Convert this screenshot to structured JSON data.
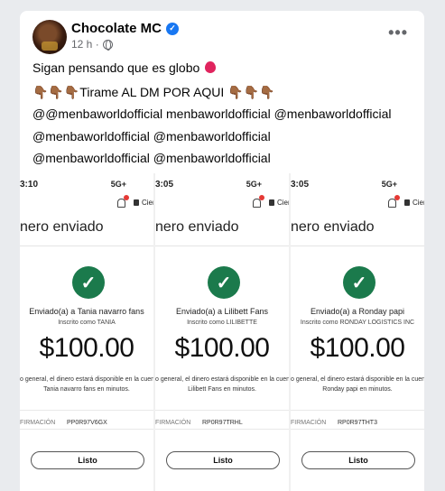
{
  "post": {
    "author": "Chocolate MC",
    "time": "12 h ·",
    "more_label": "•••",
    "lines": [
      "Sigan pensando que es globo",
      "👇🏾👇🏾👇🏾Tirame AL DM POR AQUI 👇🏾👇🏾👇🏾",
      "@@menbaworldofficial menbaworldofficial @menbaworldofficial",
      "@menbaworldofficial @menbaworldofficial",
      "@menbaworldofficial @menbaworldofficial"
    ]
  },
  "screenshots": [
    {
      "time": "3:10",
      "signal": "5G+",
      "close": "Cierr",
      "heading": "nero enviado",
      "sent_to": "Enviado(a) a Tania navarro fans",
      "inscrito": "Inscrito como TANIA",
      "amount": "$100.00",
      "avail_1": "o general, el dinero estará disponible en la cuen",
      "avail_2": "Tania navarro fans en minutos.",
      "firma": "FIRMACIÓN",
      "ref": "PP0R97V6GX",
      "button": "Listo"
    },
    {
      "time": "3:05",
      "signal": "5G+",
      "close": "Cierr",
      "heading": "nero enviado",
      "sent_to": "Enviado(a) a Lilibett Fans",
      "inscrito": "Inscrito como LILIBETTE",
      "amount": "$100.00",
      "avail_1": "o general, el dinero estará disponible en la cuen",
      "avail_2": "Lilibett Fans en minutos.",
      "firma": "FIRMACIÓN",
      "ref": "RP0R97TRHL",
      "button": "Listo"
    },
    {
      "time": "3:05",
      "signal": "5G+",
      "close": "Cierr",
      "heading": "nero enviado",
      "sent_to": "Enviado(a) a Ronday papi",
      "inscrito": "Inscrito como RONDAY LOGISTICS INC",
      "amount": "$100.00",
      "avail_1": "o general, el dinero estará disponible en la cuen",
      "avail_2": "Ronday papi en minutos.",
      "firma": "FIRMACIÓN",
      "ref": "RP0R97THT3",
      "button": "Listo"
    }
  ],
  "icons": {
    "verified": "verified-badge-icon",
    "privacy": "globe-icon",
    "balloon": "balloon-icon",
    "success": "checkmark-icon",
    "notification": "bell-icon",
    "lock": "lock-icon"
  },
  "colors": {
    "verified": "#1877f2",
    "success": "#1b7a4c",
    "balloon": "#e0245e"
  }
}
